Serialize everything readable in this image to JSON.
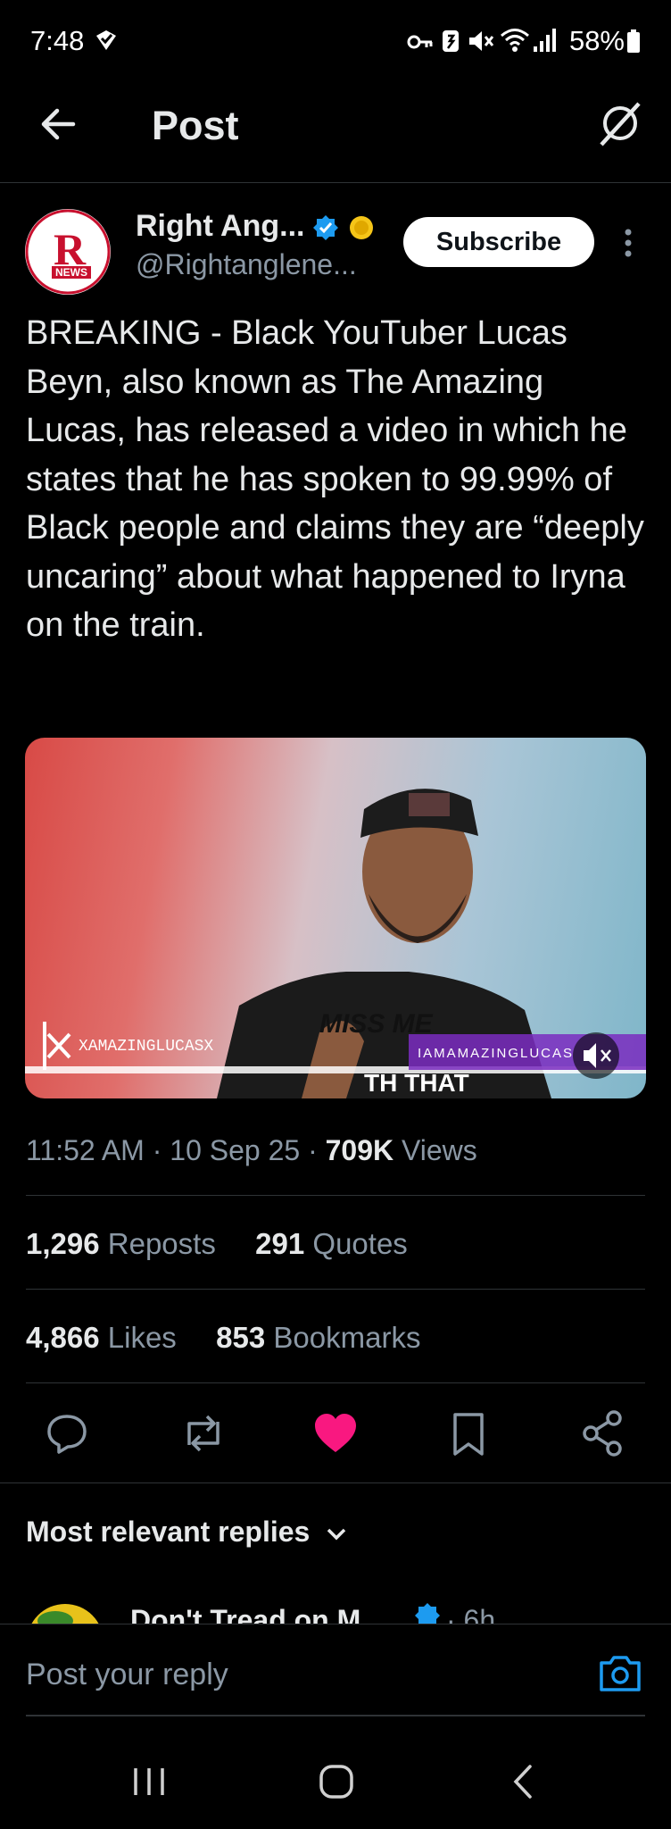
{
  "status_bar": {
    "time": "7:48",
    "battery": "58%"
  },
  "header": {
    "title": "Post"
  },
  "author": {
    "name": "Right Ang...",
    "handle": "@Rightanglene...",
    "avatar_text": "R",
    "avatar_badge": "NEWS"
  },
  "subscribe_label": "Subscribe",
  "post": {
    "text": "BREAKING - Black YouTuber Lucas Beyn, also known as The Amazing Lucas, has released a video in which he states that he has spoken to 99.99% of Black people and claims they are “deeply uncaring” about what happened to Iryna on the train."
  },
  "video": {
    "handle_left": "XAMAZINGLUCASX",
    "handle_right": "IAMAMAZINGLUCAS",
    "caption_top": "MISS ME",
    "caption_bottom": "TH THAT"
  },
  "meta": {
    "time": "11:52 AM",
    "date": "10 Sep 25",
    "views_count": "709K",
    "views_label": "Views"
  },
  "stats": {
    "reposts_count": "1,296",
    "reposts_label": "Reposts",
    "quotes_count": "291",
    "quotes_label": "Quotes",
    "likes_count": "4,866",
    "likes_label": "Likes",
    "bookmarks_count": "853",
    "bookmarks_label": "Bookmarks"
  },
  "colors": {
    "like_active": "#f91880",
    "verified": "#1d9bf0",
    "gold_badge": "#f5c518",
    "camera": "#1d9bf0"
  },
  "replies": {
    "sort_label": "Most relevant replies",
    "peek_name": "Don't Tread on M",
    "peek_time": "· 6h"
  },
  "composer": {
    "placeholder": "Post your reply"
  }
}
